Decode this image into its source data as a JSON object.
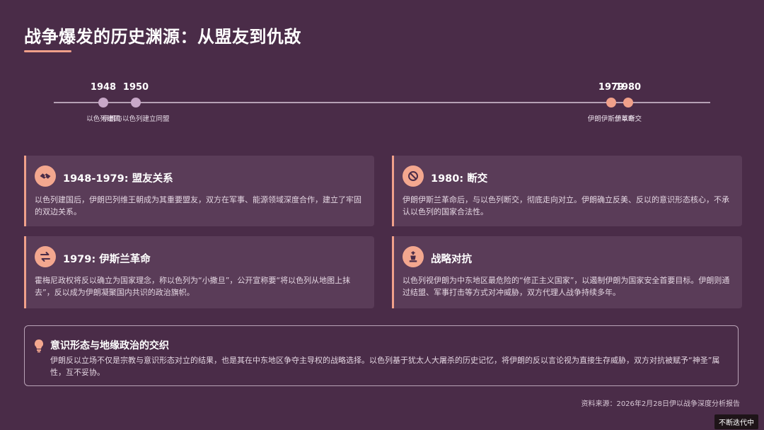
{
  "title": "战争爆发的历史渊源：从盟友到仇敌",
  "timeline": {
    "events": [
      {
        "year": "1948",
        "label": "以色列建国"
      },
      {
        "year": "1950",
        "label": "伊朗与以色列建立同盟"
      },
      {
        "year": "1979",
        "label": "伊朗伊斯兰革命"
      },
      {
        "year": "1980",
        "label": "伊以断交"
      }
    ]
  },
  "cards": [
    {
      "title": "1948-1979: 盟友关系",
      "icon": "handshake-icon",
      "text": "以色列建国后，伊朗巴列维王朝成为其重要盟友，双方在军事、能源领域深度合作，建立了牢固的双边关系。"
    },
    {
      "title": "1980: 断交",
      "icon": "ban-icon",
      "text": "伊朗伊斯兰革命后，与以色列断交，彻底走向对立。伊朗确立反美、反以的意识形态核心，不承认以色列的国家合法性。"
    },
    {
      "title": "1979: 伊斯兰革命",
      "icon": "exchange-icon",
      "text": "霍梅尼政权将反以确立为国家理念，称以色列为“小撒旦”，公开宣称要“将以色列从地图上抹去”，反以成为伊朗凝聚国内共识的政治旗帜。"
    },
    {
      "title": "战略对抗",
      "icon": "chess-icon",
      "text": "以色列视伊朗为中东地区最危险的“修正主义国家”，以遏制伊朗为国家安全首要目标。伊朗则通过结盟、军事打击等方式对冲威胁，双方代理人战争持续多年。"
    }
  ],
  "summary": {
    "title": "意识形态与地缘政治的交织",
    "text": "伊朗反以立场不仅是宗教与意识形态对立的结果，也是其在中东地区争夺主导权的战略选择。以色列基于犹太人大屠杀的历史记忆，将伊朗的反以言论视为直接生存威胁，双方对抗被赋予“神圣”属性，互不妥协。"
  },
  "source": "资料来源：2026年2月28日伊以战争深度分析报告",
  "badge": "不断迭代中",
  "colors": {
    "background": "#4a2c48",
    "card": "#5a3c58",
    "accent": "#f0a08a"
  }
}
